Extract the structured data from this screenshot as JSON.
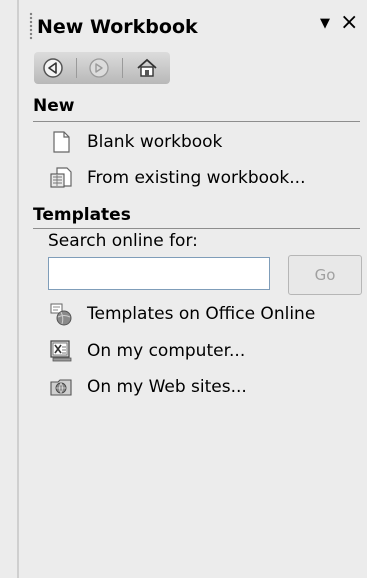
{
  "pane": {
    "title": "New Workbook",
    "menu_arrow": "▼",
    "close": "×"
  },
  "nav": {
    "back": "back-icon",
    "forward": "forward-icon",
    "home": "home-icon"
  },
  "new_section": {
    "heading": "New",
    "items": [
      {
        "label": "Blank workbook",
        "icon": "blank-document-icon"
      },
      {
        "label": "From existing workbook...",
        "icon": "existing-workbook-icon"
      }
    ]
  },
  "templates_section": {
    "heading": "Templates",
    "search_label": "Search online for:",
    "search_value": "",
    "go_label": "Go",
    "items": [
      {
        "label": "Templates on Office Online",
        "icon": "office-online-icon"
      },
      {
        "label": "On my computer...",
        "icon": "computer-templates-icon"
      },
      {
        "label": "On my Web sites...",
        "icon": "web-sites-icon"
      }
    ]
  }
}
